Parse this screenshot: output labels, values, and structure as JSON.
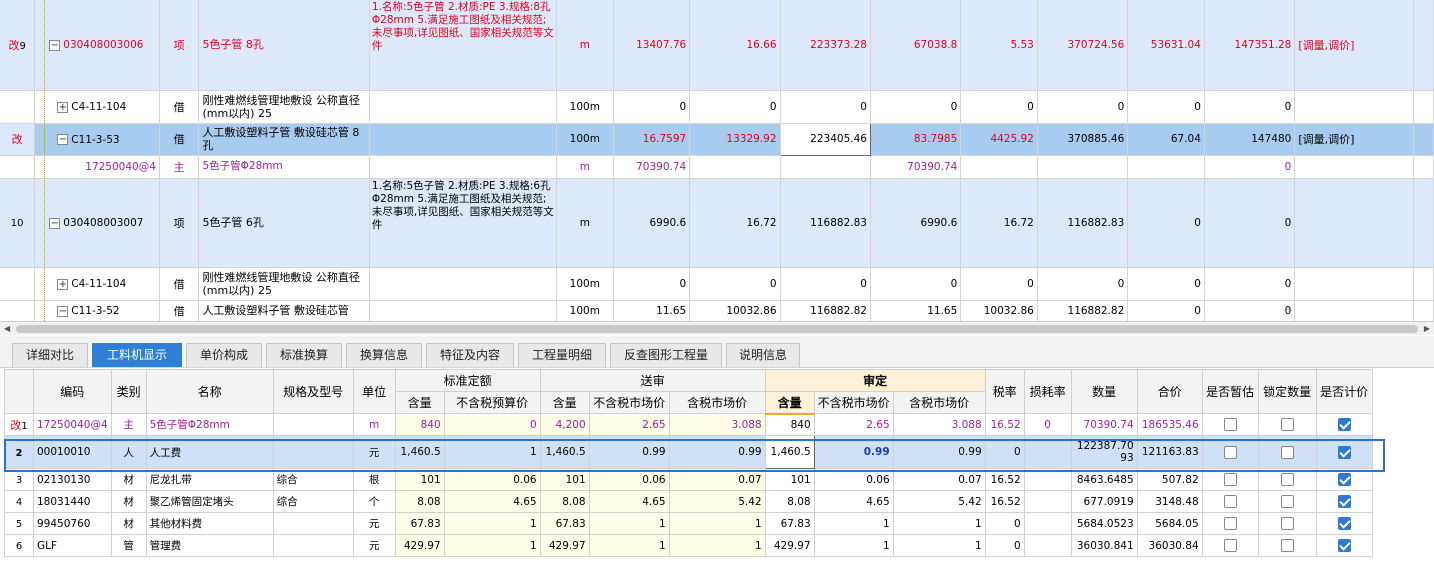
{
  "top": {
    "rows": [
      {
        "mark": "改",
        "num": "9",
        "code": "030408003006",
        "type": "项",
        "name": "5色子管 8孔",
        "spec": "1.名称:5色子管\n2.材质:PE\n3.规格:8孔Φ28mm\n5.满足施工图纸及相关规范;未尽事项,详见图纸、国家相关规范等文件",
        "unit": "m",
        "c1": "13407.76",
        "c2": "16.66",
        "c3": "223373.28",
        "c4": "67038.8",
        "c5": "5.53",
        "c6": "370724.56",
        "c7": "53631.04",
        "c8": "147351.28",
        "note": "[调量,调价]"
      },
      {
        "mark": "",
        "num": "",
        "code": "C4-11-104",
        "type": "借",
        "name": "刚性难燃线管理地敷设 公称直径(mm以内) 25",
        "spec": "",
        "unit": "100m",
        "c1": "0",
        "c2": "0",
        "c3": "0",
        "c4": "0",
        "c5": "0",
        "c6": "0",
        "c7": "0",
        "c8": "0",
        "note": ""
      },
      {
        "mark": "改",
        "num": "",
        "code": "C11-3-53",
        "type": "借",
        "name": "人工敷设塑料子管 敷设硅芯管 8孔",
        "spec": "",
        "unit": "100m",
        "c1": "16.7597",
        "c2": "13329.92",
        "c3": "223405.46",
        "c4": "83.7985",
        "c5": "4425.92",
        "c6": "370885.46",
        "c7": "67.04",
        "c8": "147480",
        "note": "[调量,调价]"
      },
      {
        "mark": "",
        "num": "",
        "code": "17250040@4",
        "type": "主",
        "name": "5色子管Φ28mm",
        "spec": "",
        "unit": "m",
        "c1": "70390.74",
        "c2": "",
        "c3": "",
        "c4": "70390.74",
        "c5": "",
        "c6": "",
        "c7": "",
        "c8": "0",
        "note": ""
      },
      {
        "mark": "",
        "num": "10",
        "code": "030408003007",
        "type": "项",
        "name": "5色子管 6孔",
        "spec": "1.名称:5色子管\n2.材质:PE\n3.规格:6孔Φ28mm\n5.满足施工图纸及相关规范;未尽事项,详见图纸、国家相关规范等文件",
        "unit": "m",
        "c1": "6990.6",
        "c2": "16.72",
        "c3": "116882.83",
        "c4": "6990.6",
        "c5": "16.72",
        "c6": "116882.83",
        "c7": "0",
        "c8": "0",
        "note": ""
      },
      {
        "mark": "",
        "num": "",
        "code": "C4-11-104",
        "type": "借",
        "name": "刚性难燃线管理地敷设 公称直径(mm以内) 25",
        "spec": "",
        "unit": "100m",
        "c1": "0",
        "c2": "0",
        "c3": "0",
        "c4": "0",
        "c5": "0",
        "c6": "0",
        "c7": "0",
        "c8": "0",
        "note": ""
      },
      {
        "mark": "",
        "num": "",
        "code": "C11-3-52",
        "type": "借",
        "name": "人工敷设塑料子管 敷设硅芯管",
        "spec": "",
        "unit": "100m",
        "c1": "11.65",
        "c2": "10032.86",
        "c3": "116882.82",
        "c4": "11.65",
        "c5": "10032.86",
        "c6": "116882.82",
        "c7": "0",
        "c8": "0",
        "note": ""
      }
    ]
  },
  "tabs": [
    "详细对比",
    "工料机显示",
    "单价构成",
    "标准换算",
    "换算信息",
    "特征及内容",
    "工程量明细",
    "反查图形工程量",
    "说明信息"
  ],
  "active_tab": "工料机显示",
  "bottom": {
    "headers": {
      "code": "编码",
      "cat": "类别",
      "name": "名称",
      "spec": "规格及型号",
      "unit": "单位",
      "g_std": "标准定额",
      "g_send": "送审",
      "g_audit": "审定",
      "qty": "含量",
      "std_price": "不含税预算价",
      "send_qty": "含量",
      "send_p1": "不含税市场价",
      "send_p2": "含税市场价",
      "aud_qty": "含量",
      "aud_p1": "不含税市场价",
      "aud_p2": "含税市场价",
      "tax": "税率",
      "loss": "损耗率",
      "amount": "数量",
      "total": "合价",
      "temp": "是否暂估",
      "lock": "锁定数量",
      "count": "是否计价"
    },
    "rows": [
      {
        "idx": "1",
        "mark": "改",
        "code": "17250040@4",
        "cat": "主",
        "name": "5色子管Φ28mm",
        "spec": "",
        "unit": "m",
        "qty": "840",
        "std_price": "0",
        "send_qty": "4,200",
        "send_p1": "2.65",
        "send_p2": "3.088",
        "aud_qty": "840",
        "aud_p1": "2.65",
        "aud_p2": "3.088",
        "tax": "16.52",
        "loss": "0",
        "amount": "70390.74",
        "total": "186535.46",
        "temp": false,
        "lock": false,
        "count": true
      },
      {
        "idx": "2",
        "mark": "",
        "code": "00010010",
        "cat": "人",
        "name": "人工费",
        "spec": "",
        "unit": "元",
        "qty": "1,460.5",
        "std_price": "1",
        "send_qty": "1,460.5",
        "send_p1": "0.99",
        "send_p2": "0.99",
        "aud_qty": "1,460.5",
        "aud_p1": "0.99",
        "aud_p2": "0.99",
        "tax": "0",
        "loss": "",
        "amount": "122387.7093",
        "total": "121163.83",
        "temp": false,
        "lock": false,
        "count": true
      },
      {
        "idx": "3",
        "mark": "",
        "code": "02130130",
        "cat": "材",
        "name": "尼龙扎带",
        "spec": "综合",
        "unit": "根",
        "qty": "101",
        "std_price": "0.06",
        "send_qty": "101",
        "send_p1": "0.06",
        "send_p2": "0.07",
        "aud_qty": "101",
        "aud_p1": "0.06",
        "aud_p2": "0.07",
        "tax": "16.52",
        "loss": "",
        "amount": "8463.6485",
        "total": "507.82",
        "temp": false,
        "lock": false,
        "count": true
      },
      {
        "idx": "4",
        "mark": "",
        "code": "18031440",
        "cat": "材",
        "name": "聚乙烯管固定堵头",
        "spec": "综合",
        "unit": "个",
        "qty": "8.08",
        "std_price": "4.65",
        "send_qty": "8.08",
        "send_p1": "4.65",
        "send_p2": "5.42",
        "aud_qty": "8.08",
        "aud_p1": "4.65",
        "aud_p2": "5.42",
        "tax": "16.52",
        "loss": "",
        "amount": "677.0919",
        "total": "3148.48",
        "temp": false,
        "lock": false,
        "count": true
      },
      {
        "idx": "5",
        "mark": "",
        "code": "99450760",
        "cat": "材",
        "name": "其他材料费",
        "spec": "",
        "unit": "元",
        "qty": "67.83",
        "std_price": "1",
        "send_qty": "67.83",
        "send_p1": "1",
        "send_p2": "1",
        "aud_qty": "67.83",
        "aud_p1": "1",
        "aud_p2": "1",
        "tax": "0",
        "loss": "",
        "amount": "5684.0523",
        "total": "5684.05",
        "temp": false,
        "lock": false,
        "count": true
      },
      {
        "idx": "6",
        "mark": "",
        "code": "GLF",
        "cat": "管",
        "name": "管理费",
        "spec": "",
        "unit": "元",
        "qty": "429.97",
        "std_price": "1",
        "send_qty": "429.97",
        "send_p1": "1",
        "send_p2": "1",
        "aud_qty": "429.97",
        "aud_p1": "1",
        "aud_p2": "1",
        "tax": "0",
        "loss": "",
        "amount": "36030.841",
        "total": "36030.84",
        "temp": false,
        "lock": false,
        "count": true
      }
    ]
  }
}
